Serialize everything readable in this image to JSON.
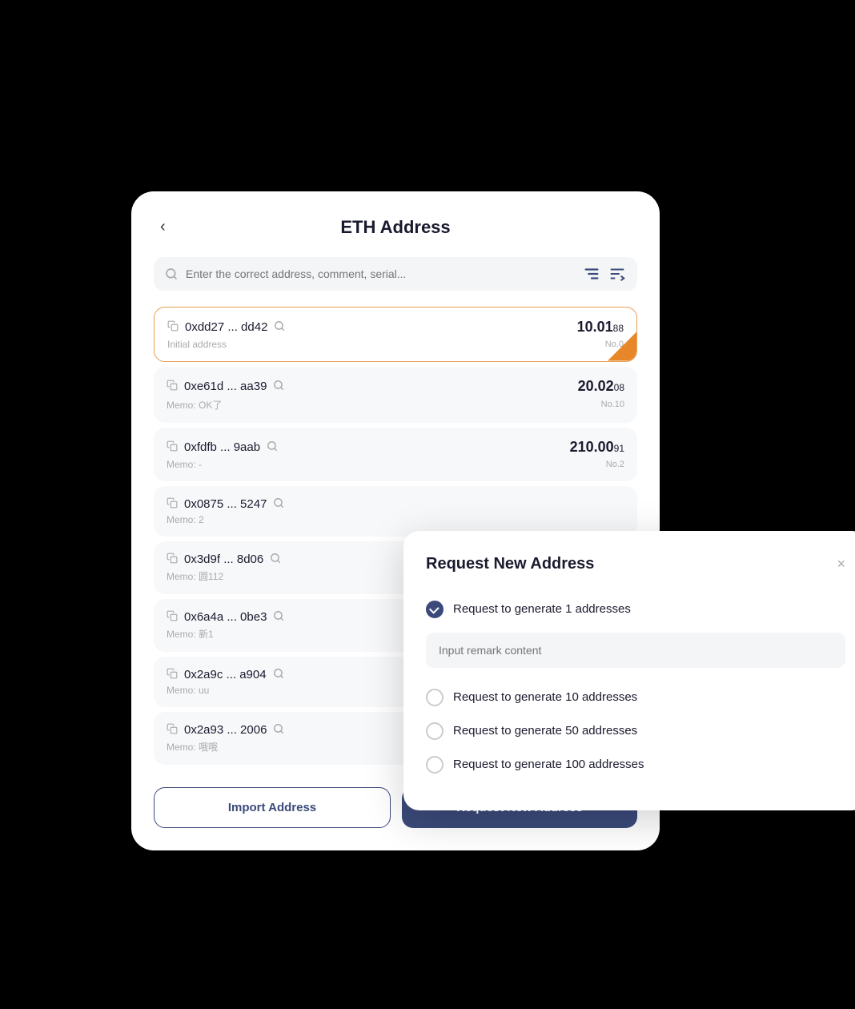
{
  "page": {
    "title": "ETH Address",
    "back_label": "‹"
  },
  "search": {
    "placeholder": "Enter the correct address, comment, serial..."
  },
  "addresses": [
    {
      "id": "addr-0",
      "text": "0xdd27 ... dd42",
      "memo": "Initial address",
      "amount_main": "10.01",
      "amount_small": "88",
      "no": "No.0",
      "active": true
    },
    {
      "id": "addr-1",
      "text": "0xe61d ... aa39",
      "memo": "Memo: OK了",
      "amount_main": "20.02",
      "amount_small": "08",
      "no": "No.10",
      "active": false
    },
    {
      "id": "addr-2",
      "text": "0xfdfb ... 9aab",
      "memo": "Memo: -",
      "amount_main": "210.00",
      "amount_small": "91",
      "no": "No.2",
      "active": false
    },
    {
      "id": "addr-3",
      "text": "0x0875 ... 5247",
      "memo": "Memo: 2",
      "amount_main": "",
      "amount_small": "",
      "no": "",
      "active": false
    },
    {
      "id": "addr-4",
      "text": "0x3d9f ... 8d06",
      "memo": "Memo: 圆112",
      "amount_main": "",
      "amount_small": "",
      "no": "",
      "active": false
    },
    {
      "id": "addr-5",
      "text": "0x6a4a ... 0be3",
      "memo": "Memo: 新1",
      "amount_main": "",
      "amount_small": "",
      "no": "",
      "active": false
    },
    {
      "id": "addr-6",
      "text": "0x2a9c ... a904",
      "memo": "Memo: uu",
      "amount_main": "",
      "amount_small": "",
      "no": "",
      "active": false
    },
    {
      "id": "addr-7",
      "text": "0x2a93 ... 2006",
      "memo": "Memo: 哦哦",
      "amount_main": "",
      "amount_small": "",
      "no": "",
      "active": false
    }
  ],
  "buttons": {
    "import": "Import Address",
    "request": "Request New Address"
  },
  "modal": {
    "title": "Request New Address",
    "close_label": "×",
    "remark_placeholder": "Input remark content",
    "options": [
      {
        "label": "Request to generate 1 addresses",
        "checked": true
      },
      {
        "label": "Request to generate 10 addresses",
        "checked": false
      },
      {
        "label": "Request to generate 50 addresses",
        "checked": false
      },
      {
        "label": "Request to generate 100 addresses",
        "checked": false
      }
    ]
  }
}
